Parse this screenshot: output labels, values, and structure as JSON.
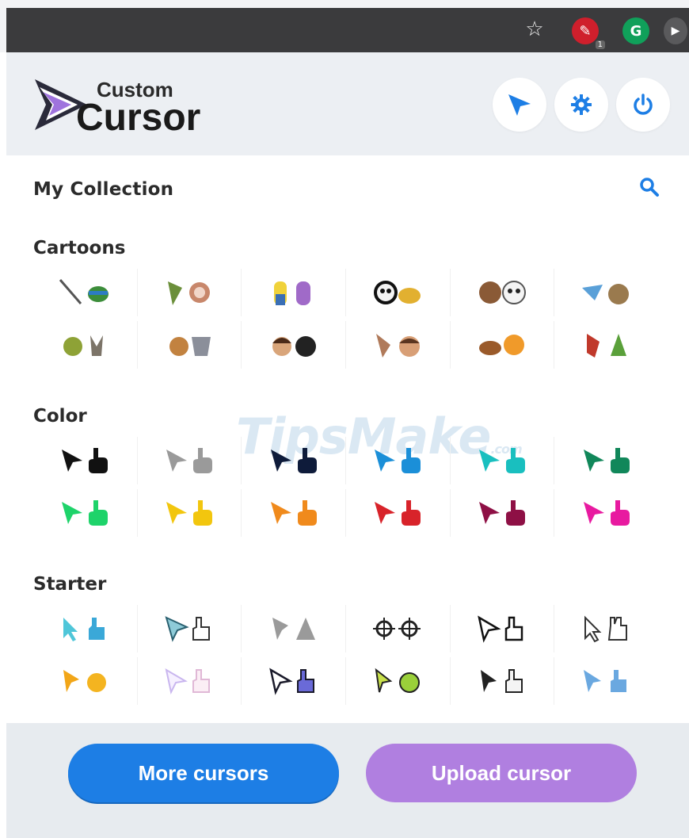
{
  "browser": {
    "star_glyph": "☆",
    "extensions": [
      {
        "name": "ext-red",
        "glyph": "✎",
        "badge": "1",
        "color": "#cf1f2c"
      },
      {
        "name": "ext-green",
        "glyph": "G",
        "color": "#10a05a"
      },
      {
        "name": "ext-more",
        "glyph": "▶",
        "color": "#5a5a5c"
      }
    ]
  },
  "logo": {
    "line1": "Custom",
    "line2": "Cursor"
  },
  "header_buttons": [
    {
      "icon": "cursor-icon"
    },
    {
      "icon": "gear-icon"
    },
    {
      "icon": "power-icon"
    }
  ],
  "collection": {
    "title": "My Collection",
    "search_icon": "search-icon"
  },
  "sections": [
    {
      "title": "Cartoons"
    },
    {
      "title": "Color"
    },
    {
      "title": "Starter"
    }
  ],
  "colors": {
    "row1": [
      [
        "#111111",
        "#111111"
      ],
      [
        "#9a9a9a",
        "#9a9a9a"
      ],
      [
        "#0e1b3a",
        "#0e1b3a"
      ],
      [
        "#1b8fd8",
        "#1b8fd8"
      ],
      [
        "#19bfbf",
        "#19bfbf"
      ],
      [
        "#11875a",
        "#11875a"
      ]
    ],
    "row2": [
      [
        "#1ed36a",
        "#1ed36a"
      ],
      [
        "#f2c60e",
        "#f2c60e"
      ],
      [
        "#f08a1c",
        "#f08a1c"
      ],
      [
        "#d8232a",
        "#d8232a"
      ],
      [
        "#8e1045",
        "#8e1045"
      ],
      [
        "#e81aa0",
        "#e81aa0"
      ]
    ],
    "primary_blue": "#1d7ee5",
    "upload_purple": "#b07fe0",
    "header_icon_blue": "#1d7ee5"
  },
  "watermark": {
    "text": "TipsMake",
    "suffix": ".com"
  },
  "footer": {
    "more_label": "More cursors",
    "upload_label": "Upload cursor"
  }
}
